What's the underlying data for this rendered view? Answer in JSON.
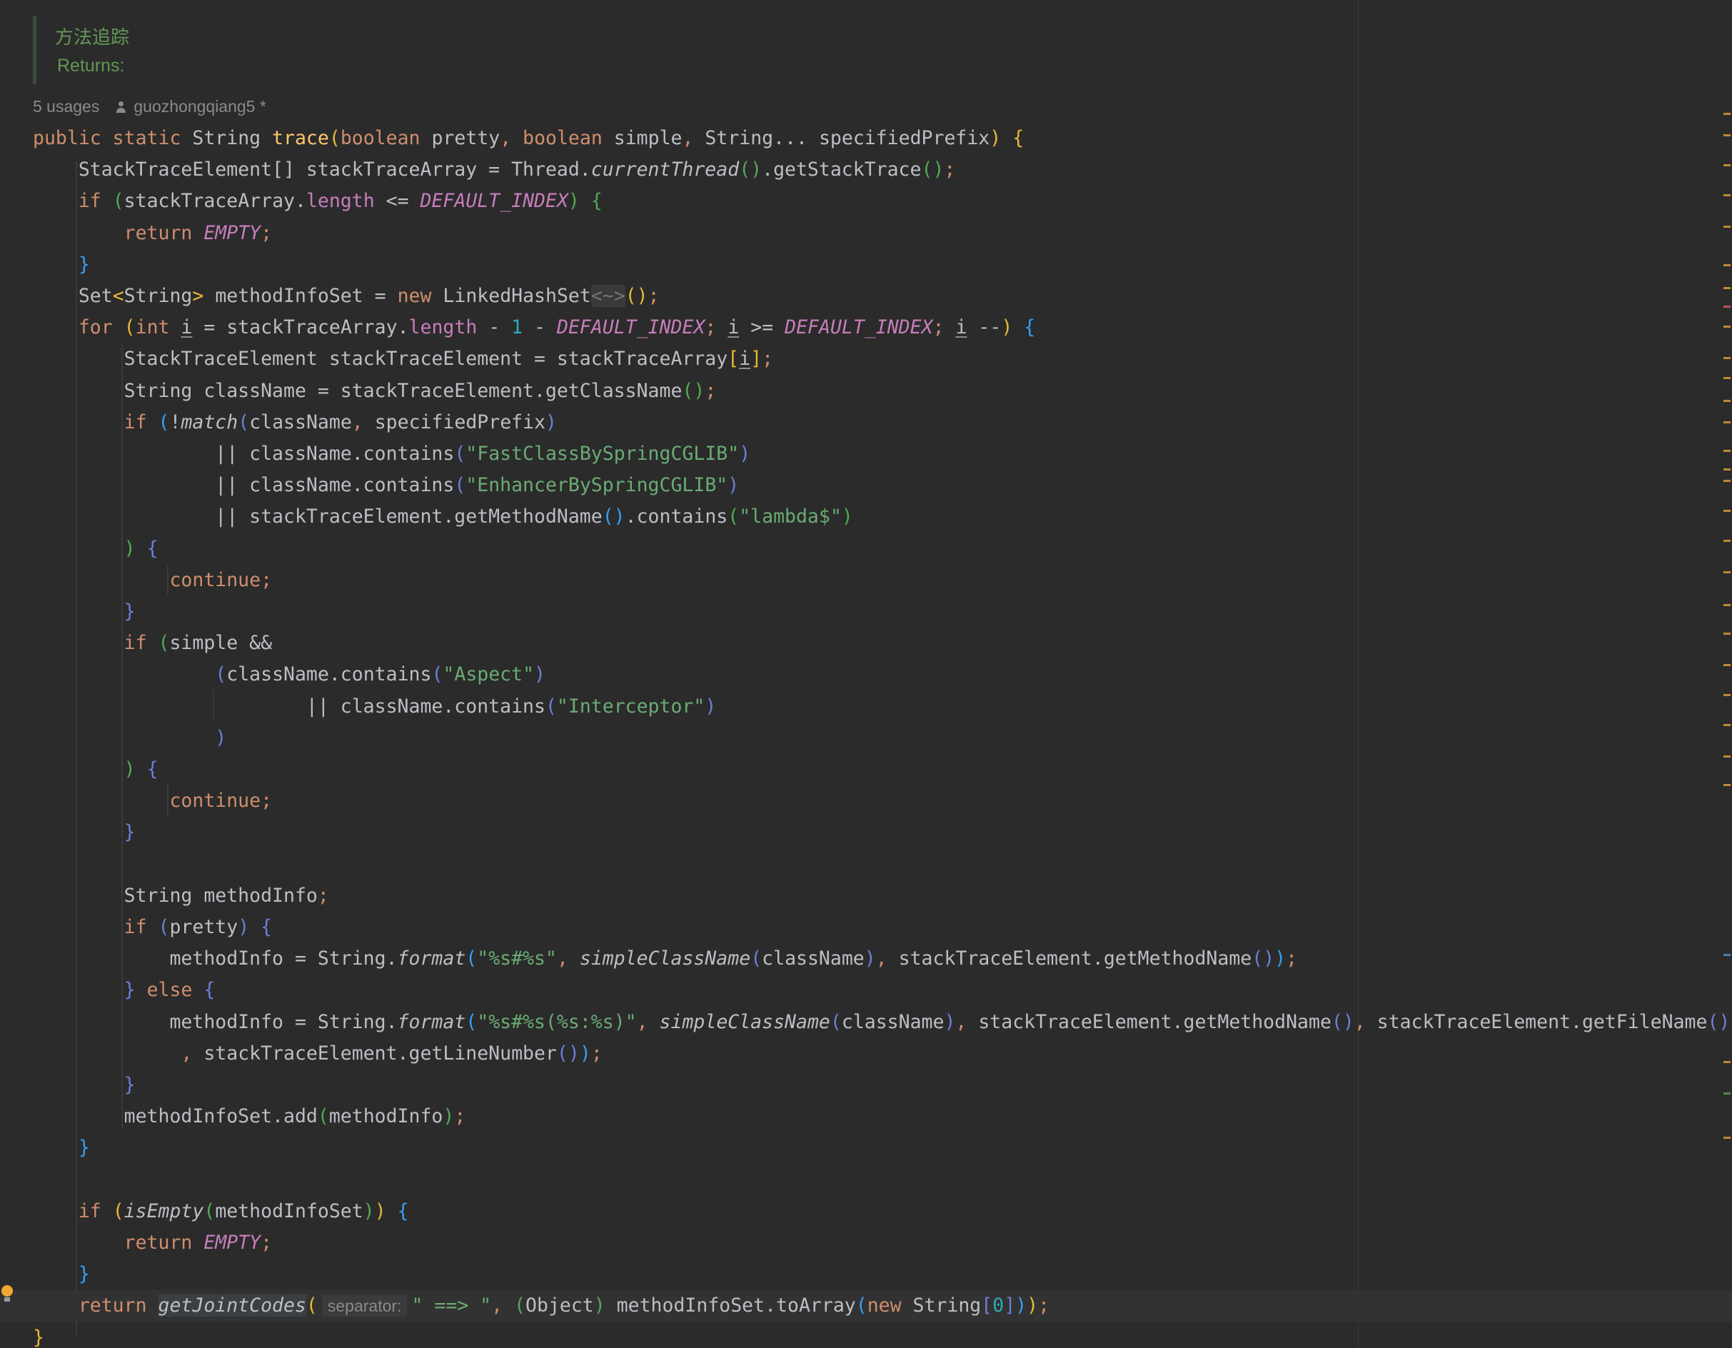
{
  "doc": {
    "title": "方法追踪",
    "returns": "Returns:"
  },
  "inlay": {
    "usages": "5 usages",
    "author": "guozhongqiang5 *"
  },
  "hint": {
    "separator": "separator:"
  },
  "colors": {
    "background": "#2b2b2b",
    "keyword": "#cf8e6d",
    "method": "#ffc66d",
    "string": "#6aab73",
    "constant": "#c77dbb",
    "doc": "#629755"
  },
  "icons": [
    "person-icon",
    "intention-bulb-icon"
  ],
  "code_lines": [
    [
      [
        "kw",
        "public static "
      ],
      [
        "ty",
        "String "
      ],
      [
        "m",
        "trace"
      ],
      [
        "br1",
        "("
      ],
      [
        "kw",
        "boolean "
      ],
      [
        "ty",
        "pretty"
      ],
      [
        "pn",
        ", "
      ],
      [
        "kw",
        "boolean "
      ],
      [
        "ty",
        "simple"
      ],
      [
        "pn",
        ", "
      ],
      [
        "ty",
        "String... specifiedPrefix"
      ],
      [
        "br1",
        ")"
      ],
      [
        "ty",
        " "
      ],
      [
        "br1",
        "{"
      ]
    ],
    [
      [
        "ty",
        "    StackTraceElement[] stackTraceArray = Thread."
      ],
      [
        "ital",
        "currentThread"
      ],
      [
        "br2",
        "()"
      ],
      [
        "ty",
        ".getStackTrace"
      ],
      [
        "br2",
        "()"
      ],
      [
        "pn",
        ";"
      ]
    ],
    [
      [
        "kw",
        "    if "
      ],
      [
        "br2",
        "("
      ],
      [
        "ty",
        "stackTraceArray."
      ],
      [
        "fld",
        "length"
      ],
      [
        "ty",
        " <= "
      ],
      [
        "const",
        "DEFAULT_INDEX"
      ],
      [
        "br2",
        ")"
      ],
      [
        "ty",
        " "
      ],
      [
        "br2",
        "{"
      ]
    ],
    [
      [
        "kw",
        "        return "
      ],
      [
        "const",
        "EMPTY"
      ],
      [
        "pn",
        ";"
      ]
    ],
    [
      [
        "ty",
        "    "
      ],
      [
        "br3",
        "}"
      ]
    ],
    [
      [
        "ty",
        "    Set"
      ],
      [
        "br1",
        "<"
      ],
      [
        "ty",
        "String"
      ],
      [
        "br1",
        ">"
      ],
      [
        "ty",
        " methodInfoSet = "
      ],
      [
        "kw",
        "new "
      ],
      [
        "ty",
        "LinkedHashSet"
      ],
      [
        "diamond",
        "<~>"
      ],
      [
        "br1",
        "()"
      ],
      [
        "pn",
        ";"
      ]
    ],
    [
      [
        "kw",
        "    for "
      ],
      [
        "br1",
        "("
      ],
      [
        "kw",
        "int "
      ],
      [
        "und",
        "i"
      ],
      [
        "ty",
        " = stackTraceArray."
      ],
      [
        "fld",
        "length"
      ],
      [
        "ty",
        " - "
      ],
      [
        "num",
        "1"
      ],
      [
        "ty",
        " - "
      ],
      [
        "const",
        "DEFAULT_INDEX"
      ],
      [
        "pn",
        "; "
      ],
      [
        "und",
        "i"
      ],
      [
        "ty",
        " >= "
      ],
      [
        "const",
        "DEFAULT_INDEX"
      ],
      [
        "pn",
        "; "
      ],
      [
        "und",
        "i"
      ],
      [
        "ty",
        " --"
      ],
      [
        "br1",
        ")"
      ],
      [
        "ty",
        " "
      ],
      [
        "br3",
        "{"
      ]
    ],
    [
      [
        "ty",
        "        StackTraceElement stackTraceElement = stackTraceArray"
      ],
      [
        "br1",
        "["
      ],
      [
        "und",
        "i"
      ],
      [
        "br1",
        "]"
      ],
      [
        "pn",
        ";"
      ]
    ],
    [
      [
        "ty",
        "        String className = stackTraceElement.getClassName"
      ],
      [
        "br2",
        "()"
      ],
      [
        "pn",
        ";"
      ]
    ],
    [
      [
        "kw",
        "        if "
      ],
      [
        "br3",
        "("
      ],
      [
        "ty",
        "!"
      ],
      [
        "ital",
        "match"
      ],
      [
        "br4",
        "("
      ],
      [
        "ty",
        "className"
      ],
      [
        "pn",
        ", "
      ],
      [
        "ty",
        "specifiedPrefix"
      ],
      [
        "br4",
        ")"
      ]
    ],
    [
      [
        "ty",
        "                || className.contains"
      ],
      [
        "br4",
        "("
      ],
      [
        "st",
        "\"FastClassBySpringCGLIB\""
      ],
      [
        "br4",
        ")"
      ]
    ],
    [
      [
        "ty",
        "                || className.contains"
      ],
      [
        "br4",
        "("
      ],
      [
        "st",
        "\"EnhancerBySpringCGLIB\""
      ],
      [
        "br4",
        ")"
      ]
    ],
    [
      [
        "ty",
        "                || stackTraceElement.getMethodName"
      ],
      [
        "br3",
        "()"
      ],
      [
        "ty",
        ".contains"
      ],
      [
        "br2",
        "("
      ],
      [
        "st",
        "\"lambda$\""
      ],
      [
        "br2",
        ")"
      ]
    ],
    [
      [
        "ty",
        "        "
      ],
      [
        "br2",
        ")"
      ],
      [
        "ty",
        " "
      ],
      [
        "br4",
        "{"
      ]
    ],
    [
      [
        "kw",
        "            continue"
      ],
      [
        "pn",
        ";"
      ]
    ],
    [
      [
        "ty",
        "        "
      ],
      [
        "br4",
        "}"
      ]
    ],
    [
      [
        "kw",
        "        if "
      ],
      [
        "br2",
        "("
      ],
      [
        "ty",
        "simple &&"
      ]
    ],
    [
      [
        "ty",
        "                "
      ],
      [
        "br4",
        "("
      ],
      [
        "ty",
        "className.contains"
      ],
      [
        "br4",
        "("
      ],
      [
        "st",
        "\"Aspect\""
      ],
      [
        "br4",
        ")"
      ]
    ],
    [
      [
        "ty",
        "                        || className.contains"
      ],
      [
        "br4",
        "("
      ],
      [
        "st",
        "\"Interceptor\""
      ],
      [
        "br4",
        ")"
      ]
    ],
    [
      [
        "ty",
        "                "
      ],
      [
        "br4",
        ")"
      ]
    ],
    [
      [
        "ty",
        "        "
      ],
      [
        "br2",
        ")"
      ],
      [
        "ty",
        " "
      ],
      [
        "br4",
        "{"
      ]
    ],
    [
      [
        "kw",
        "            continue"
      ],
      [
        "pn",
        ";"
      ]
    ],
    [
      [
        "ty",
        "        "
      ],
      [
        "br4",
        "}"
      ]
    ],
    [
      [
        "ty",
        ""
      ]
    ],
    [
      [
        "ty",
        "        String methodInfo"
      ],
      [
        "pn",
        ";"
      ]
    ],
    [
      [
        "kw",
        "        if "
      ],
      [
        "br4",
        "("
      ],
      [
        "ty",
        "pretty"
      ],
      [
        "br4",
        ")"
      ],
      [
        "ty",
        " "
      ],
      [
        "br4",
        "{"
      ]
    ],
    [
      [
        "ty",
        "            methodInfo = String."
      ],
      [
        "ital",
        "format"
      ],
      [
        "br3",
        "("
      ],
      [
        "st",
        "\"%s#%s\""
      ],
      [
        "pn",
        ", "
      ],
      [
        "ital",
        "simpleClassName"
      ],
      [
        "br4",
        "("
      ],
      [
        "ty",
        "className"
      ],
      [
        "br4",
        ")"
      ],
      [
        "pn",
        ", "
      ],
      [
        "ty",
        "stackTraceElement.getMethodName"
      ],
      [
        "br4",
        "()"
      ],
      [
        "br3",
        ")"
      ],
      [
        "pn",
        ";"
      ]
    ],
    [
      [
        "ty",
        "        "
      ],
      [
        "br4",
        "}"
      ],
      [
        "kw",
        " else "
      ],
      [
        "br4",
        "{"
      ]
    ],
    [
      [
        "ty",
        "            methodInfo = String."
      ],
      [
        "ital",
        "format"
      ],
      [
        "br3",
        "("
      ],
      [
        "st",
        "\"%s#%s(%s:%s)\""
      ],
      [
        "pn",
        ", "
      ],
      [
        "ital",
        "simpleClassName"
      ],
      [
        "br4",
        "("
      ],
      [
        "ty",
        "className"
      ],
      [
        "br4",
        ")"
      ],
      [
        "pn",
        ", "
      ],
      [
        "ty",
        "stackTraceElement.getMethodName"
      ],
      [
        "br4",
        "()"
      ],
      [
        "pn",
        ", "
      ],
      [
        "ty",
        "stackTraceElement.getFileName"
      ],
      [
        "br4",
        "()"
      ]
    ],
    [
      [
        "pn",
        "             , "
      ],
      [
        "ty",
        "stackTraceElement.getLineNumber"
      ],
      [
        "br4",
        "()"
      ],
      [
        "br3",
        ")"
      ],
      [
        "pn",
        ";"
      ]
    ],
    [
      [
        "ty",
        "        "
      ],
      [
        "br4",
        "}"
      ]
    ],
    [
      [
        "ty",
        "        methodInfoSet.add"
      ],
      [
        "br2",
        "("
      ],
      [
        "ty",
        "methodInfo"
      ],
      [
        "br2",
        ")"
      ],
      [
        "pn",
        ";"
      ]
    ],
    [
      [
        "ty",
        "    "
      ],
      [
        "br3",
        "}"
      ]
    ],
    [
      [
        "ty",
        ""
      ]
    ],
    [
      [
        "kw",
        "    if "
      ],
      [
        "br1",
        "("
      ],
      [
        "ital",
        "isEmpty"
      ],
      [
        "br2",
        "("
      ],
      [
        "ty",
        "methodInfoSet"
      ],
      [
        "br2",
        ")"
      ],
      [
        "br1",
        ")"
      ],
      [
        "ty",
        " "
      ],
      [
        "br3",
        "{"
      ]
    ],
    [
      [
        "kw",
        "        return "
      ],
      [
        "const",
        "EMPTY"
      ],
      [
        "pn",
        ";"
      ]
    ],
    [
      [
        "ty",
        "    "
      ],
      [
        "br3",
        "}"
      ]
    ],
    [
      [
        "kw",
        "    return "
      ],
      [
        "hl",
        "getJointCodes"
      ],
      [
        "br1",
        "("
      ],
      [
        "hint",
        "separator:"
      ],
      [
        "st",
        "\" ==> \""
      ],
      [
        "pn",
        ", "
      ],
      [
        "br2",
        "("
      ],
      [
        "ty",
        "Object"
      ],
      [
        "br2",
        ")"
      ],
      [
        "ty",
        " methodInfoSet.toArray"
      ],
      [
        "br3",
        "("
      ],
      [
        "kw",
        "new "
      ],
      [
        "ty",
        "String"
      ],
      [
        "br4",
        "["
      ],
      [
        "num",
        "0"
      ],
      [
        "br4",
        "]"
      ],
      [
        "br3",
        ")"
      ],
      [
        "br1",
        ")"
      ],
      [
        "pn",
        ";"
      ]
    ],
    [
      [
        "br1",
        "}"
      ]
    ]
  ]
}
